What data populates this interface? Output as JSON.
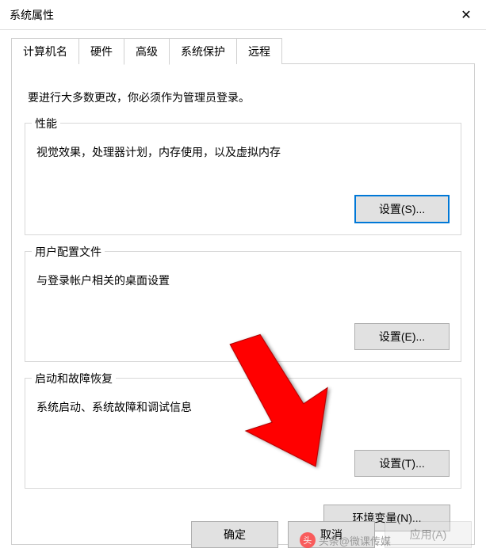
{
  "titlebar": {
    "title": "系统属性"
  },
  "tabs": {
    "items": [
      {
        "label": "计算机名"
      },
      {
        "label": "硬件"
      },
      {
        "label": "高级"
      },
      {
        "label": "系统保护"
      },
      {
        "label": "远程"
      }
    ],
    "active_index": 2
  },
  "panel": {
    "intro": "要进行大多数更改，你必须作为管理员登录。",
    "performance": {
      "title": "性能",
      "desc": "视觉效果，处理器计划，内存使用，以及虚拟内存",
      "button": "设置(S)..."
    },
    "user_profiles": {
      "title": "用户配置文件",
      "desc": "与登录帐户相关的桌面设置",
      "button": "设置(E)..."
    },
    "startup_recovery": {
      "title": "启动和故障恢复",
      "desc": "系统启动、系统故障和调试信息",
      "button": "设置(T)..."
    },
    "env_button": "环境变量(N)..."
  },
  "bottom": {
    "ok": "确定",
    "cancel": "取消",
    "apply": "应用(A)"
  },
  "watermark": {
    "text": "头条@微课传媒"
  }
}
